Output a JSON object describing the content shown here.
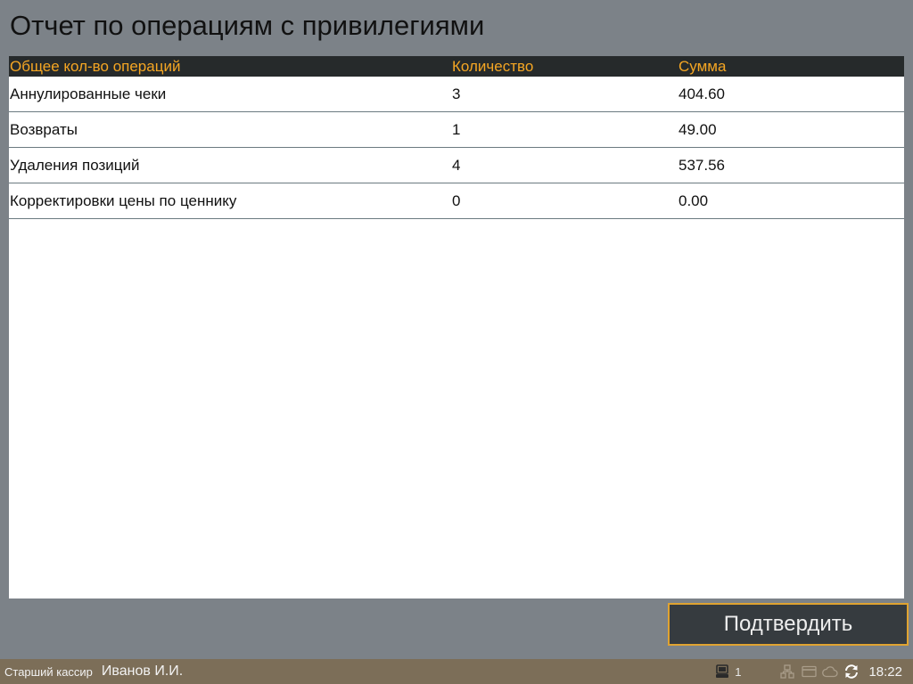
{
  "header": {
    "title": "Отчет по операциям с привилегиями"
  },
  "table": {
    "columns": [
      "Общее кол-во операций",
      "Количество",
      "Сумма"
    ],
    "rows": [
      {
        "name": "Аннулированные чеки",
        "qty": "3",
        "sum": "404.60"
      },
      {
        "name": "Возвраты",
        "qty": "1",
        "sum": "49.00"
      },
      {
        "name": "Удаления позиций",
        "qty": "4",
        "sum": "537.56"
      },
      {
        "name": "Корректировки цены по ценнику",
        "qty": "0",
        "sum": "0.00"
      }
    ]
  },
  "actions": {
    "confirm_label": "Подтвердить"
  },
  "status_bar": {
    "role": "Старший кассир",
    "user": "Иванов И.И.",
    "terminal_count": "1",
    "time": "18:22",
    "icons": [
      "terminal-icon",
      "network-icon",
      "card-icon",
      "cloud-icon",
      "sync-icon"
    ]
  },
  "colors": {
    "background": "#7c8288",
    "header_bg": "#262a2b",
    "header_text": "#f5a623",
    "button_border": "#e0a331",
    "status_bar": "#7c6e58"
  }
}
